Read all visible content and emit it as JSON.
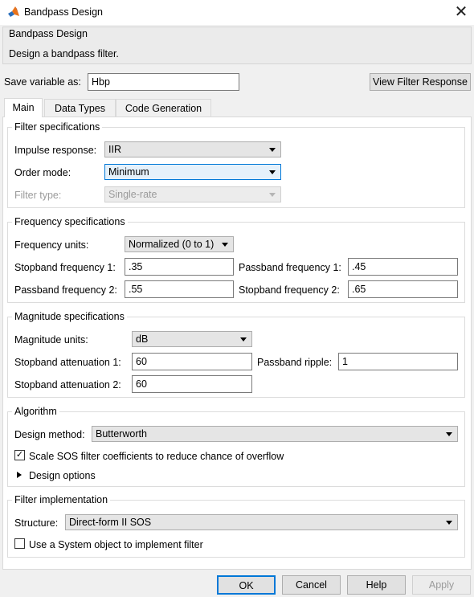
{
  "window": {
    "title": "Bandpass Design",
    "close_symbol": "✕"
  },
  "header": {
    "title": "Bandpass Design",
    "description": "Design a bandpass filter."
  },
  "save": {
    "label": "Save variable as:",
    "value": "Hbp",
    "view_button": "View Filter Response"
  },
  "tabs": [
    {
      "label": "Main",
      "active": true
    },
    {
      "label": "Data Types",
      "active": false
    },
    {
      "label": "Code Generation",
      "active": false
    }
  ],
  "filter_specs": {
    "title": "Filter specifications",
    "impulse_label": "Impulse response:",
    "impulse_value": "IIR",
    "order_label": "Order mode:",
    "order_value": "Minimum",
    "type_label": "Filter type:",
    "type_value": "Single-rate"
  },
  "freq_specs": {
    "title": "Frequency specifications",
    "units_label": "Frequency units:",
    "units_value": "Normalized (0 to 1)",
    "stop1_label": "Stopband frequency 1:",
    "stop1_value": ".35",
    "pass1_label": "Passband frequency 1:",
    "pass1_value": ".45",
    "pass2_label": "Passband frequency 2:",
    "pass2_value": ".55",
    "stop2_label": "Stopband frequency 2:",
    "stop2_value": ".65"
  },
  "mag_specs": {
    "title": "Magnitude specifications",
    "units_label": "Magnitude units:",
    "units_value": "dB",
    "att1_label": "Stopband attenuation 1:",
    "att1_value": "60",
    "ripple_label": "Passband ripple:",
    "ripple_value": "1",
    "att2_label": "Stopband attenuation 2:",
    "att2_value": "60"
  },
  "algorithm": {
    "title": "Algorithm",
    "method_label": "Design method:",
    "method_value": "Butterworth",
    "scale_label": "Scale SOS filter coefficients to reduce chance of overflow",
    "scale_checked": "✓",
    "options_label": "Design options"
  },
  "implementation": {
    "title": "Filter implementation",
    "structure_label": "Structure:",
    "structure_value": "Direct-form II SOS",
    "sysobj_label": "Use a System object to implement filter"
  },
  "buttons": {
    "ok": "OK",
    "cancel": "Cancel",
    "help": "Help",
    "apply": "Apply"
  },
  "colors": {
    "accent": "#0078d7",
    "disabled_text": "#9b9b9b"
  }
}
